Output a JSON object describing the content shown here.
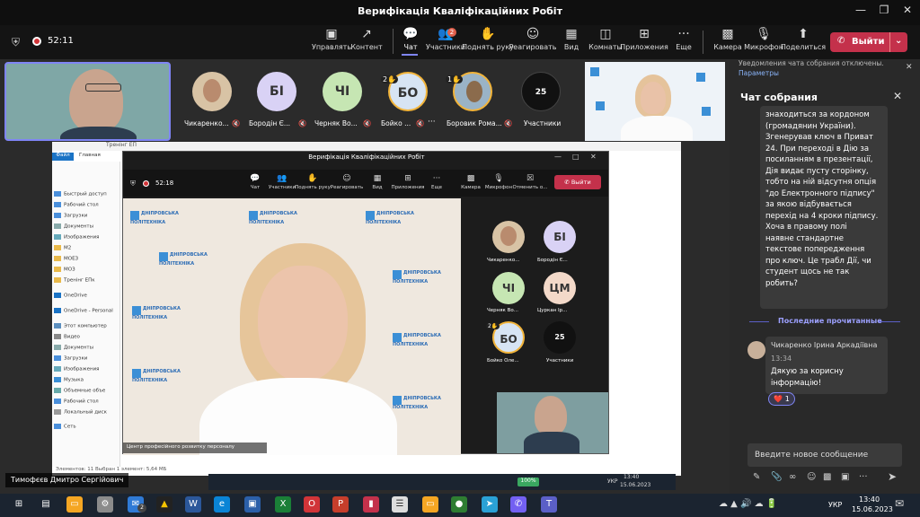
{
  "window": {
    "title": "Верифікація Кваліфікаційних Робіт",
    "timer": "52:11"
  },
  "toolbar": {
    "items": [
      {
        "label": "Управлять",
        "icon": "share-screen-icon"
      },
      {
        "label": "Контент",
        "icon": "content-icon"
      },
      {
        "label": "Чат",
        "icon": "chat-icon"
      },
      {
        "label": "Участники",
        "icon": "participants-icon",
        "badge": "2"
      },
      {
        "label": "Поднять руку",
        "icon": "raise-hand-icon"
      },
      {
        "label": "Реагировать",
        "icon": "react-icon"
      },
      {
        "label": "Вид",
        "icon": "view-icon"
      },
      {
        "label": "Комнаты",
        "icon": "rooms-icon"
      },
      {
        "label": "Приложения",
        "icon": "apps-icon"
      },
      {
        "label": "Еще",
        "icon": "more-icon"
      },
      {
        "label": "Камера",
        "icon": "camera-icon"
      },
      {
        "label": "Микрофон",
        "icon": "microphone-off-icon"
      },
      {
        "label": "Поделиться",
        "icon": "share-icon"
      }
    ],
    "leave_label": "Выйти"
  },
  "participants": [
    {
      "name": "Чикаренко...",
      "initials": ""
    },
    {
      "name": "Бородін Є...",
      "initials": "БІ"
    },
    {
      "name": "Черняк Во...",
      "initials": "ЧІ"
    },
    {
      "name": "Бойко ...",
      "initials": "БО",
      "hand": "2"
    },
    {
      "name": "Боровик Рома...",
      "initials": "",
      "hand": "1"
    },
    {
      "name": "Участники",
      "initials": "25"
    }
  ],
  "chat": {
    "notice": "Уведомления чата собрания отключены.",
    "notice_link": "Параметры",
    "title": "Чат собрания",
    "message1_lines": [
      "знаходиться за кордоном",
      "(громадянин України).",
      "Згенерував ключ в Приват",
      "24. При переході в Дію за",
      "посиланням в презентації,",
      "Дія видає пусту сторінку,",
      "тобто на ній відсутня опція",
      "\"до Електронного підпису\"",
      "за якою відбувається",
      "перехід на 4 кроки підпису.",
      "Хоча в правому полі",
      "наявне стандартне",
      "текстове попередження",
      "про ключ. Це трабл Дії, чи",
      "студент щось не так",
      "робить?"
    ],
    "last_read_label": "Последние прочитанные",
    "message2": {
      "author": "Чикаренко Ірина Аркадіївна",
      "time": "13:34",
      "lines": [
        "Дякую за корисну",
        "інформацію!"
      ],
      "reaction": "❤️",
      "reaction_count": "1"
    },
    "input_placeholder": "Введите новое сообщение"
  },
  "inner_meeting": {
    "title": "Верифікація Кваліфікаційних Робіт",
    "timer": "52:18",
    "toolbar": [
      "Чат",
      "Участники",
      "Поднять руку",
      "Реагировать",
      "Вид",
      "Приложения",
      "Еще",
      "Камера",
      "Микрофон",
      "Отменить о..."
    ],
    "leave_label": "Выйти",
    "participants": [
      {
        "name": "Чикаренко...",
        "initials": ""
      },
      {
        "name": "Бородін Є...",
        "initials": "БІ"
      },
      {
        "name": "Черняк Во...",
        "initials": "ЧІ"
      },
      {
        "name": "Цуркан Ір...",
        "initials": "ЦМ"
      },
      {
        "name": "Бойко Оле...",
        "initials": "БО",
        "hand": "2"
      },
      {
        "name": "Участники",
        "initials": "25"
      }
    ],
    "speaker_caption": "Центр професійного розвитку персоналу"
  },
  "logo_text": [
    "ДНІПРОВСЬКА",
    "ПОЛІТЕХНІКА"
  ],
  "explorer": {
    "title": "Тренінг ЕП",
    "tabs": [
      "Файл",
      "Главная"
    ],
    "sidebar": [
      "Быстрый доступ",
      "Рабочий стол",
      "Загрузки",
      "Документы",
      "Изображения",
      "М2",
      "МОЕЗ",
      "МОЗ",
      "Тренінг ЕПк",
      "OneDrive",
      "OneDrive - Personal",
      "Этот компьютер",
      "Видео",
      "Документы",
      "Загрузки",
      "Изображения",
      "Музыка",
      "Объемные объе",
      "Рабочий стол",
      "Локальный диск",
      "Сеть"
    ],
    "status": "Элементов: 11    Выбран 1 элемент: 5,64 МБ"
  },
  "inner_taskbar": {
    "battery": "100%",
    "lang": "УКР",
    "time": "13:40",
    "date": "15.06.2023"
  },
  "self_name": "Тимофєєв Дмитро Сергійович",
  "taskbar": {
    "lang": "УКР",
    "time": "13:40",
    "date": "15.06.2023",
    "notify_count": "2"
  }
}
